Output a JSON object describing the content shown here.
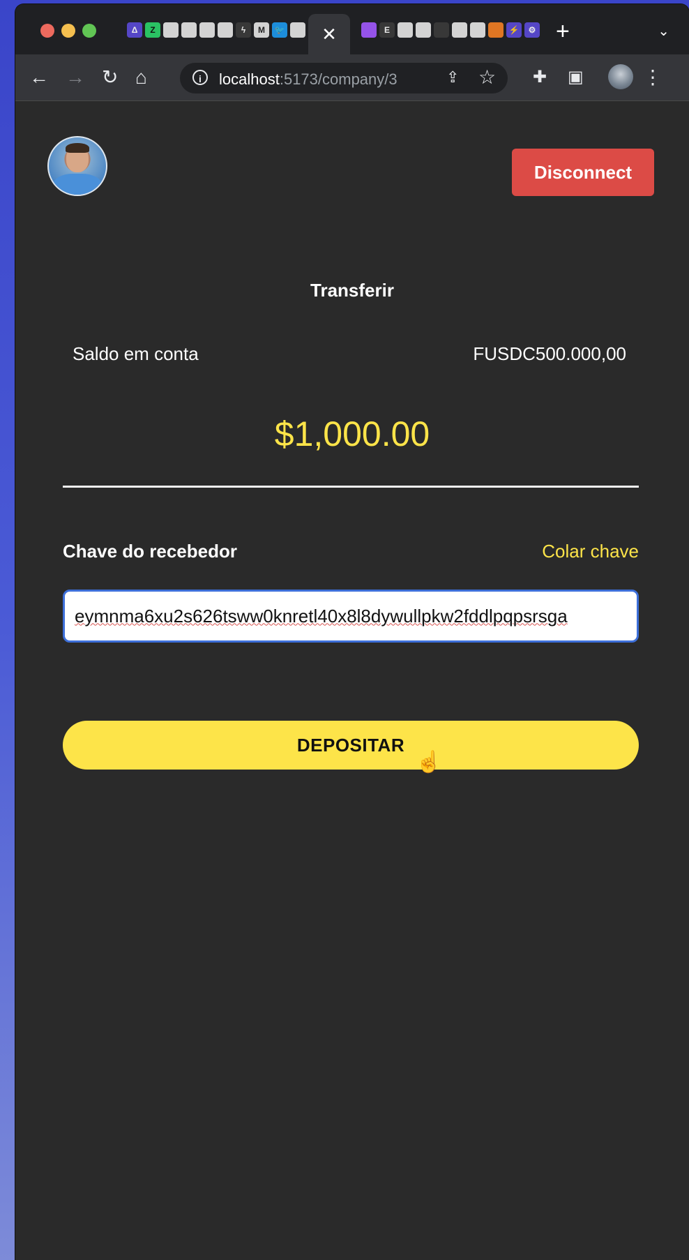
{
  "browser": {
    "active_tab_close": "✕",
    "new_tab": "+",
    "tab_menu": "⌄",
    "url_host": "localhost",
    "url_path": ":5173/company/3",
    "url_full": "localhost:5173/company/3"
  },
  "header": {
    "disconnect_label": "Disconnect"
  },
  "transfer": {
    "title": "Transferir",
    "balance_label": "Saldo em conta",
    "balance_value": "FUSDC500.000,00",
    "amount": "$1,000.00",
    "recipient_key_label": "Chave do recebedor",
    "paste_key_label": "Colar chave",
    "recipient_key_value": "eymnma6xu2s626tsww0knretl40x8l8dywullpkw2fddlpqpsrsga",
    "deposit_label": "DEPOSITAR"
  },
  "colors": {
    "accent": "#fde449",
    "danger": "#dc4b46",
    "background": "#2a2a2a"
  }
}
